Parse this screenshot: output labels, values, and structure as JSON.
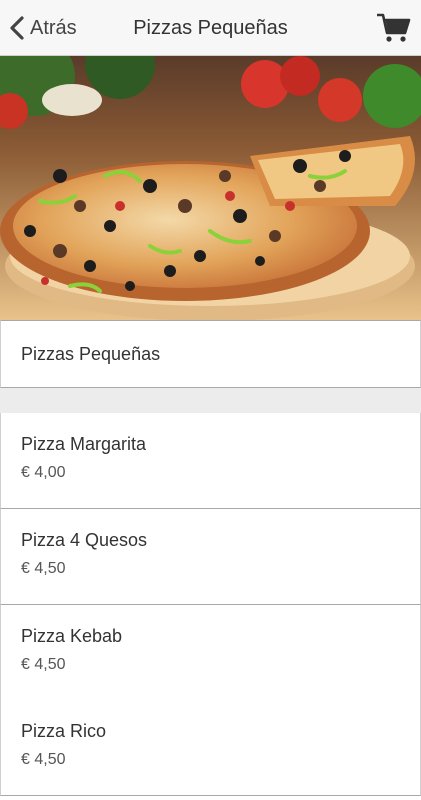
{
  "nav": {
    "back_label": "Atrás",
    "title": "Pizzas Pequeñas",
    "cart_icon": "cart-icon",
    "back_icon": "chevron-left-icon"
  },
  "hero": {
    "image": "pizza-photo"
  },
  "section": {
    "title": "Pizzas Pequeñas"
  },
  "items": [
    {
      "name": "Pizza Margarita",
      "price": "€ 4,00"
    },
    {
      "name": "Pizza 4 Quesos",
      "price": "€ 4,50"
    },
    {
      "name": "Pizza Kebab",
      "price": "€ 4,50"
    },
    {
      "name": "Pizza Rico",
      "price": "€ 4,50"
    }
  ],
  "colors": {
    "nav_bg": "#f7f7f7",
    "text": "#333333",
    "separator": "#a8a8a8",
    "gap_bg": "#ececec"
  }
}
